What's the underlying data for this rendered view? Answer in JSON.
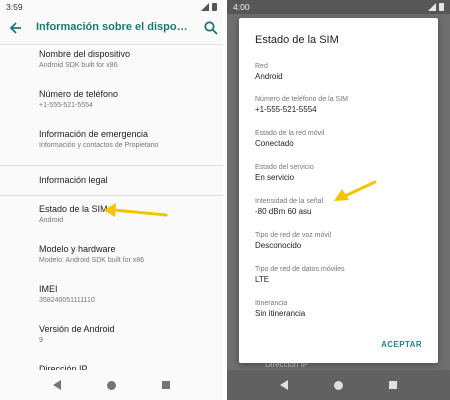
{
  "left": {
    "statusbar": {
      "time": "3:59"
    },
    "appbar": {
      "title": "Información sobre el dispositivo"
    },
    "items": [
      {
        "label": "Nombre del dispositivo",
        "sub": "Android SDK built for x86"
      },
      {
        "label": "Número de teléfono",
        "sub": "+1-555-521-5554"
      },
      {
        "label": "Información de emergencia",
        "sub": "Información y contactos de Propietario"
      },
      {
        "label": "Información legal",
        "sub": ""
      },
      {
        "label": "Estado de la SIM",
        "sub": "Android"
      },
      {
        "label": "Modelo y hardware",
        "sub": "Modelo: Android SDK built for x86"
      },
      {
        "label": "IMEI",
        "sub": "358240051111110"
      },
      {
        "label": "Versión de Android",
        "sub": "9"
      },
      {
        "label": "Dirección IP",
        "sub": ""
      }
    ]
  },
  "right": {
    "statusbar": {
      "time": "4:00"
    },
    "background_peek": "Dirección IP",
    "dialog": {
      "title": "Estado de la SIM",
      "fields": [
        {
          "label": "Red",
          "value": "Android"
        },
        {
          "label": "Número de teléfono de la SIM",
          "value": "+1-555-521-5554"
        },
        {
          "label": "Estado de la red móvil",
          "value": "Conectado"
        },
        {
          "label": "Estado del servicio",
          "value": "En servicio"
        },
        {
          "label": "Intensidad de la señal",
          "value": "-80 dBm 60 asu"
        },
        {
          "label": "Tipo de red de voz móvil",
          "value": "Desconocido"
        },
        {
          "label": "Tipo de red de datos móviles",
          "value": "LTE"
        },
        {
          "label": "Itinerancia",
          "value": "Sin itinerancia"
        }
      ],
      "accept_label": "ACEPTAR"
    }
  },
  "colors": {
    "accent": "#1b7a74",
    "arrow": "#f5c400"
  }
}
